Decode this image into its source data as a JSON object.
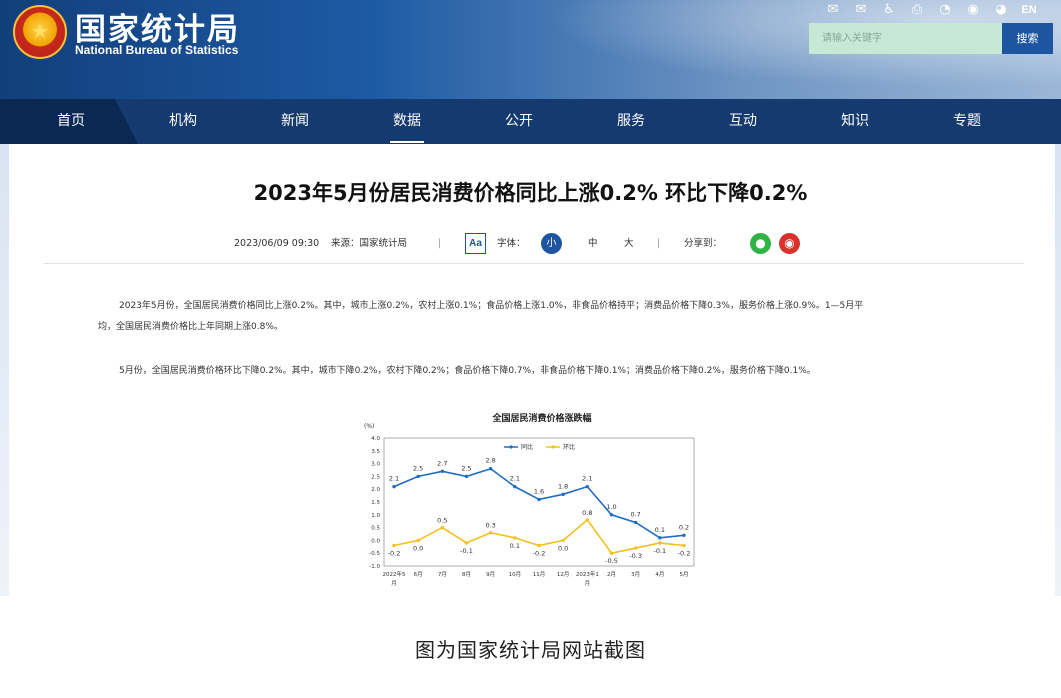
{
  "header": {
    "logo_cn": "国家统计局",
    "logo_en": "National Bureau of Statistics",
    "top_icons": [
      "mail-icon",
      "mailbox-icon",
      "accessibility-icon",
      "print-icon",
      "mini-program-icon",
      "weibo-icon",
      "wechat-icon"
    ],
    "lang_label": "EN",
    "search_placeholder": "请输入关键字",
    "search_button": "搜索"
  },
  "nav": {
    "items": [
      "首页",
      "机构",
      "新闻",
      "数据",
      "公开",
      "服务",
      "互动",
      "知识",
      "专题"
    ],
    "active_index": 3
  },
  "article": {
    "title": "2023年5月份居民消费价格同比上涨0.2% 环比下降0.2%",
    "datetime": "2023/06/09 09:30",
    "source": "来源：国家统计局",
    "sep": "|",
    "aa": "Aa",
    "font_label": "字体：",
    "font_small": "小",
    "font_medium": "中",
    "font_large": "大",
    "share_label": "分享到：",
    "para1_line1": "2023年5月份，全国居民消费价格同比上涨0.2%。其中，城市上涨0.2%，农村上涨0.1%；食品价格上涨1.0%，非食品价格持平；消费品价格下降0.3%，服务价格上涨0.9%。1—5月平",
    "para1_line2": "均，全国居民消费价格比上年同期上涨0.8%。",
    "para2": "5月份，全国居民消费价格环比下降0.2%。其中，城市下降0.2%，农村下降0.2%；食品价格下降0.7%，非食品价格下降0.1%；消费品价格下降0.2%，服务价格下降0.1%。"
  },
  "chart_data": {
    "type": "line",
    "title": "全国居民消费价格涨跌幅",
    "ylabel": "(%)",
    "xlabel": "",
    "ylim": [
      -1.0,
      4.0
    ],
    "yticks": [
      "4.0",
      "3.5",
      "3.0",
      "2.5",
      "2.0",
      "1.5",
      "1.0",
      "0.5",
      "0.0",
      "-0.5",
      "-1.0"
    ],
    "categories": [
      "2022年5月",
      "6月",
      "7月",
      "8月",
      "9月",
      "10月",
      "11月",
      "12月",
      "2023年1月",
      "2月",
      "3月",
      "4月",
      "5月"
    ],
    "series": [
      {
        "name": "同比",
        "color": "#1f6cc4",
        "values": [
          2.1,
          2.5,
          2.7,
          2.5,
          2.8,
          2.1,
          1.6,
          1.8,
          2.1,
          1.0,
          0.7,
          0.1,
          0.2
        ]
      },
      {
        "name": "环比",
        "color": "#f5c01d",
        "values": [
          -0.2,
          0.0,
          0.5,
          -0.1,
          0.3,
          0.1,
          -0.2,
          0.0,
          0.8,
          -0.5,
          -0.3,
          -0.1,
          -0.2
        ]
      }
    ],
    "grid": false,
    "legend": "top-center"
  },
  "caption": "图为国家统计局网站截图"
}
